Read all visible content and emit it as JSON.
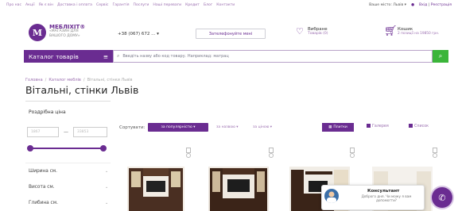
{
  "top_links": [
    "Про нас",
    "Акції",
    "Як є він",
    "Доставка і оплата",
    "Сервіс",
    "Гарантія",
    "Послуги",
    "Наші переваги",
    "Кредит",
    "Блог",
    "Контакти"
  ],
  "top_right": {
    "city": "Ваше місто: Львів ▾",
    "login": "Вхід",
    "register": "Реєстрація"
  },
  "header": {
    "logo_letter": "М",
    "brand_name": "МЕБЛІХІТ®",
    "brand_tag_1": "«МАГАЗИН ДЛЯ",
    "brand_tag_2": "ВАШОГО ДОМУ»",
    "phone": "+38 (067) 672 ...  ▾",
    "callback": "Зателефонуйте мені",
    "favorites_title": "Вибране",
    "favorites_sub": "Товарів (0)",
    "cart_title": "Кошик",
    "cart_sub": "2 позиції на 19850 грн."
  },
  "catalog": {
    "label": "Каталог товарів",
    "menu_glyph": "≡"
  },
  "search": {
    "placeholder": "Введіть назву або код товару. Наприклад: матрац",
    "button_glyph": "⌕"
  },
  "breadcrumbs": [
    "Головна",
    "Каталог меблів",
    "Вітальні, стінки Львів"
  ],
  "page_title": "Вітальні, стінки Львів",
  "sidebar": {
    "price_label": "Роздрібна ціна",
    "price_min": "1867",
    "price_max": "33853",
    "price_dash": "—",
    "filters": [
      "Ширина см.",
      "Висота см.",
      "Глибина см."
    ]
  },
  "sort": {
    "label": "Сортувати:",
    "options": [
      "за популярністю ▾",
      "за назвою ▾",
      "за ціною ▾"
    ]
  },
  "view": {
    "tile": "Плитки",
    "gallery": "Галерея",
    "list": "Список"
  },
  "chat": {
    "name": "Консультант",
    "message": "Доброго дня. Чи можу я вам допомогти?",
    "button_glyph": "✆"
  },
  "colors": {
    "brand": "#6a2c91",
    "search_button": "#3bb53a",
    "link": "#9b6fb0"
  }
}
